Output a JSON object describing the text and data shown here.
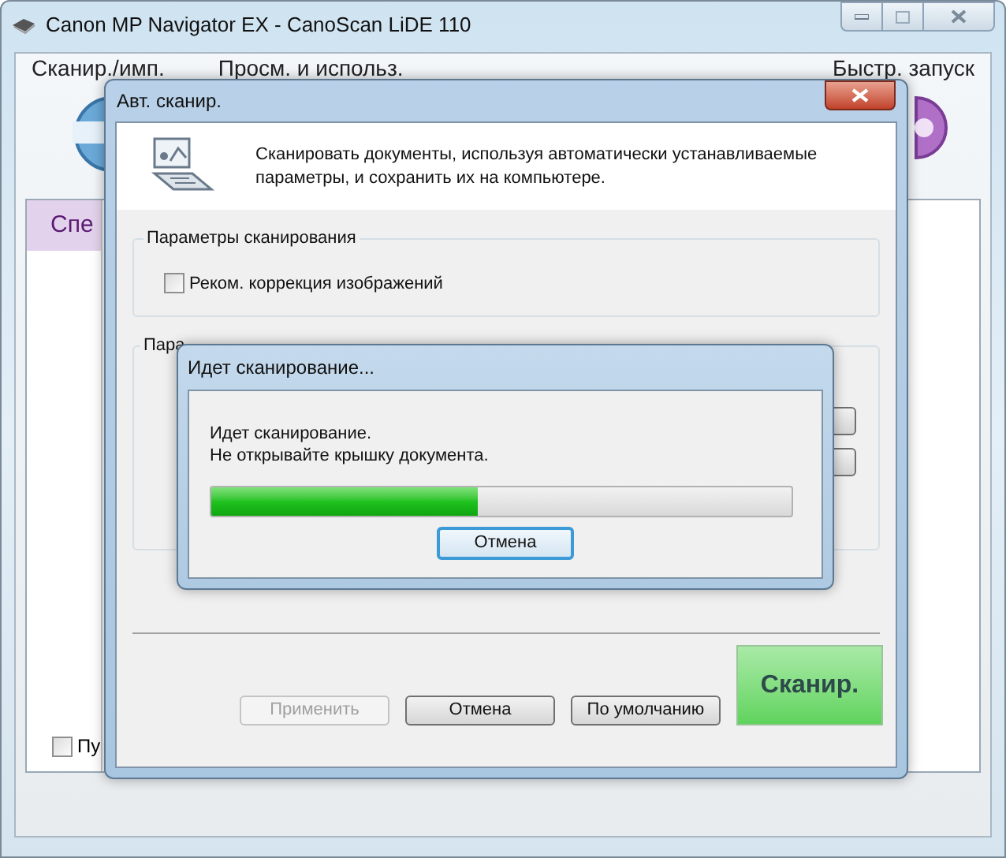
{
  "window": {
    "title": "Canon MP Navigator EX - CanoScan LiDE 110"
  },
  "nav": [
    "Сканир./имп.",
    "Просм. и использ.",
    "Быстр. запуск"
  ],
  "side_tab": {
    "label": "Спе",
    "selected": true
  },
  "bottom_checkbox": {
    "label": "Пу",
    "checked": false
  },
  "dialog": {
    "title": "Авт. сканир.",
    "description": "Сканировать документы, используя автоматически устанавливаемые параметры, и сохранить их на компьютере.",
    "groups": [
      {
        "title": "Параметры сканирования",
        "checkbox": {
          "label": "Реком. коррекция изображений",
          "checked": false
        }
      },
      {
        "title": "Пара"
      }
    ],
    "buttons": [
      {
        "label": "Применить",
        "disabled": true
      },
      {
        "label": "Отмена",
        "disabled": false
      },
      {
        "label": "По умолчанию",
        "disabled": false
      }
    ],
    "scan_button": "Сканир."
  },
  "progress": {
    "title": "Идет сканирование...",
    "lines": [
      "Идет сканирование.",
      "Не открывайте крышку документа."
    ],
    "level": 0.46,
    "cancel": "Отмена"
  }
}
